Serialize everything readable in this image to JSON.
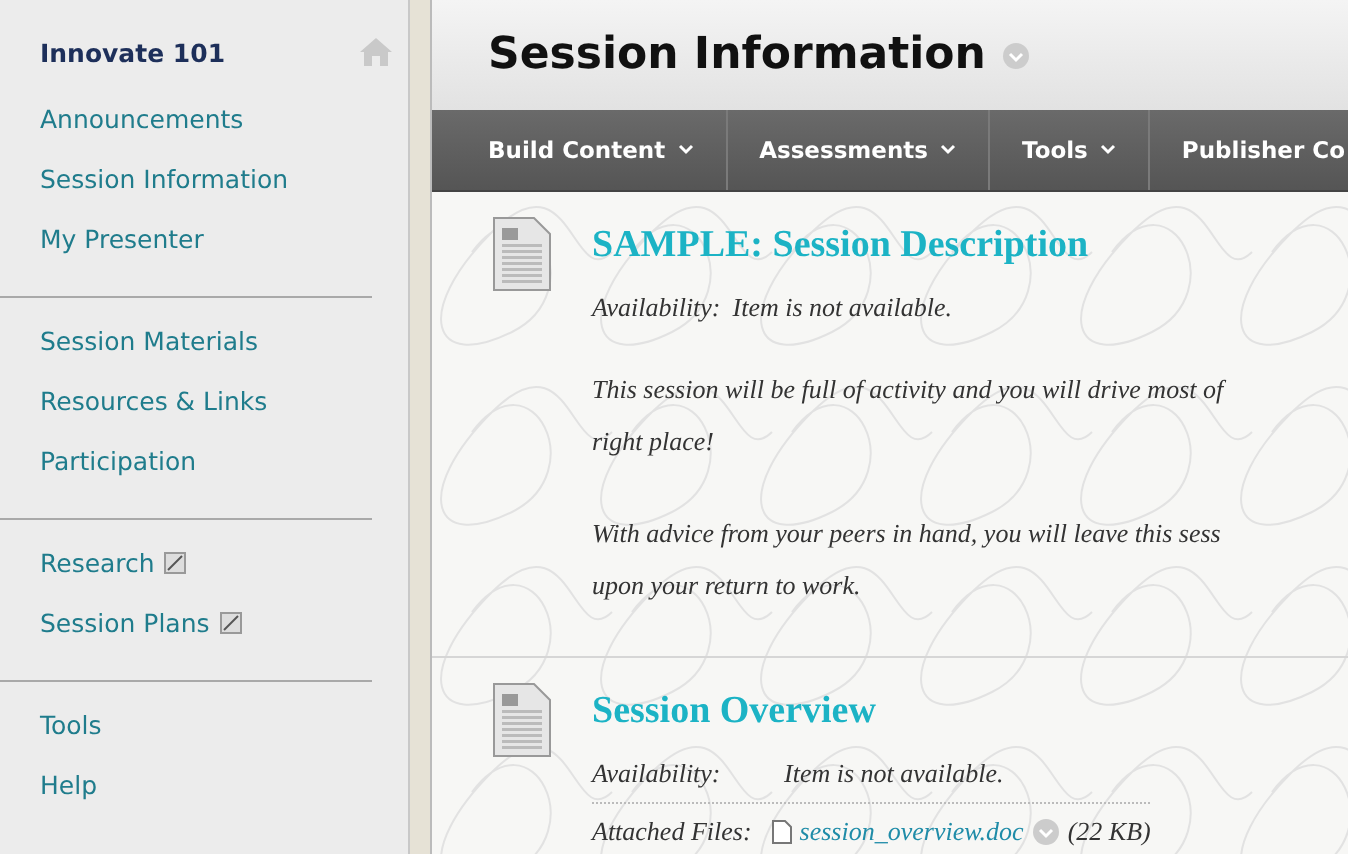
{
  "sidebar": {
    "course_title": "Innovate 101",
    "groups": [
      [
        {
          "label": "Announcements",
          "external": false
        },
        {
          "label": "Session Information",
          "external": false
        },
        {
          "label": "My Presenter",
          "external": false
        }
      ],
      [
        {
          "label": "Session Materials",
          "external": false
        },
        {
          "label": "Resources & Links",
          "external": false
        },
        {
          "label": "Participation",
          "external": false
        }
      ],
      [
        {
          "label": "Research",
          "external": true
        },
        {
          "label": "Session Plans",
          "external": true
        }
      ],
      [
        {
          "label": "Tools",
          "external": false
        },
        {
          "label": "Help",
          "external": false
        }
      ]
    ]
  },
  "page": {
    "title": "Session Information"
  },
  "toolbar": [
    {
      "label": "Build Content",
      "menu": true
    },
    {
      "label": "Assessments",
      "menu": true
    },
    {
      "label": "Tools",
      "menu": true
    },
    {
      "label": "Publisher Co",
      "menu": false
    }
  ],
  "items": [
    {
      "title": "SAMPLE: Session Description",
      "availability_label": "Availability:",
      "availability": "Item is not available.",
      "paragraphs": [
        [
          "This session will be full of activity and you will drive most of",
          "right place!"
        ],
        [
          "With advice from your peers in hand, you will leave this sess",
          "upon your return to work."
        ]
      ]
    },
    {
      "title": "Session Overview",
      "availability_label": "Availability:",
      "availability": "Item is not available.",
      "attachment": {
        "label": "Attached Files:",
        "file": "session_overview.doc",
        "size": "(22 KB)"
      }
    }
  ]
}
